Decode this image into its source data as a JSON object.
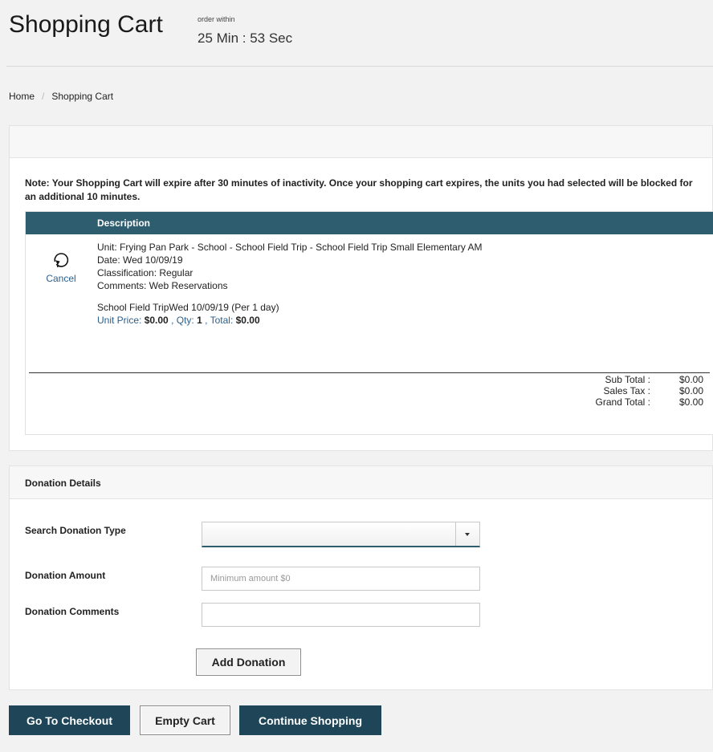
{
  "header": {
    "title": "Shopping Cart",
    "timer_label": "order within",
    "timer_value": "25 Min : 53 Sec"
  },
  "breadcrumb": {
    "home": "Home",
    "separator": "/",
    "current": "Shopping Cart"
  },
  "cart": {
    "note": "Note: Your Shopping Cart will expire after 30 minutes of inactivity. Once your shopping cart expires, the units you had selected will be blocked for an additional 10 minutes.",
    "table_header": "Description",
    "items": [
      {
        "cancel_label": "Cancel",
        "unit": "Unit: Frying Pan Park - School - School Field Trip - School Field Trip Small Elementary AM",
        "date": "Date: Wed 10/09/19",
        "classification": "Classification: Regular",
        "comments": "Comments: Web Reservations",
        "line": "School Field TripWed 10/09/19 (Per 1 day)",
        "unit_price_label": "Unit Price:",
        "unit_price": "$0.00",
        "qty_label": "Qty:",
        "qty": "1",
        "total_label": "Total:",
        "total": "$0.00"
      }
    ],
    "totals": {
      "subtotal_label": "Sub Total :",
      "subtotal": "$0.00",
      "tax_label": "Sales Tax :",
      "tax": "$0.00",
      "grand_label": "Grand Total :",
      "grand": "$0.00"
    }
  },
  "donation": {
    "title": "Donation Details",
    "type_label": "Search Donation Type",
    "type_value": "",
    "amount_label": "Donation Amount",
    "amount_placeholder": "Minimum amount $0",
    "comments_label": "Donation Comments",
    "comments_value": "",
    "add_button": "Add Donation"
  },
  "actions": {
    "checkout": "Go To Checkout",
    "empty": "Empty Cart",
    "continue": "Continue Shopping"
  },
  "colors": {
    "primary": "#1e4658",
    "table_header": "#2f5d70",
    "link": "#2b5f8c"
  }
}
